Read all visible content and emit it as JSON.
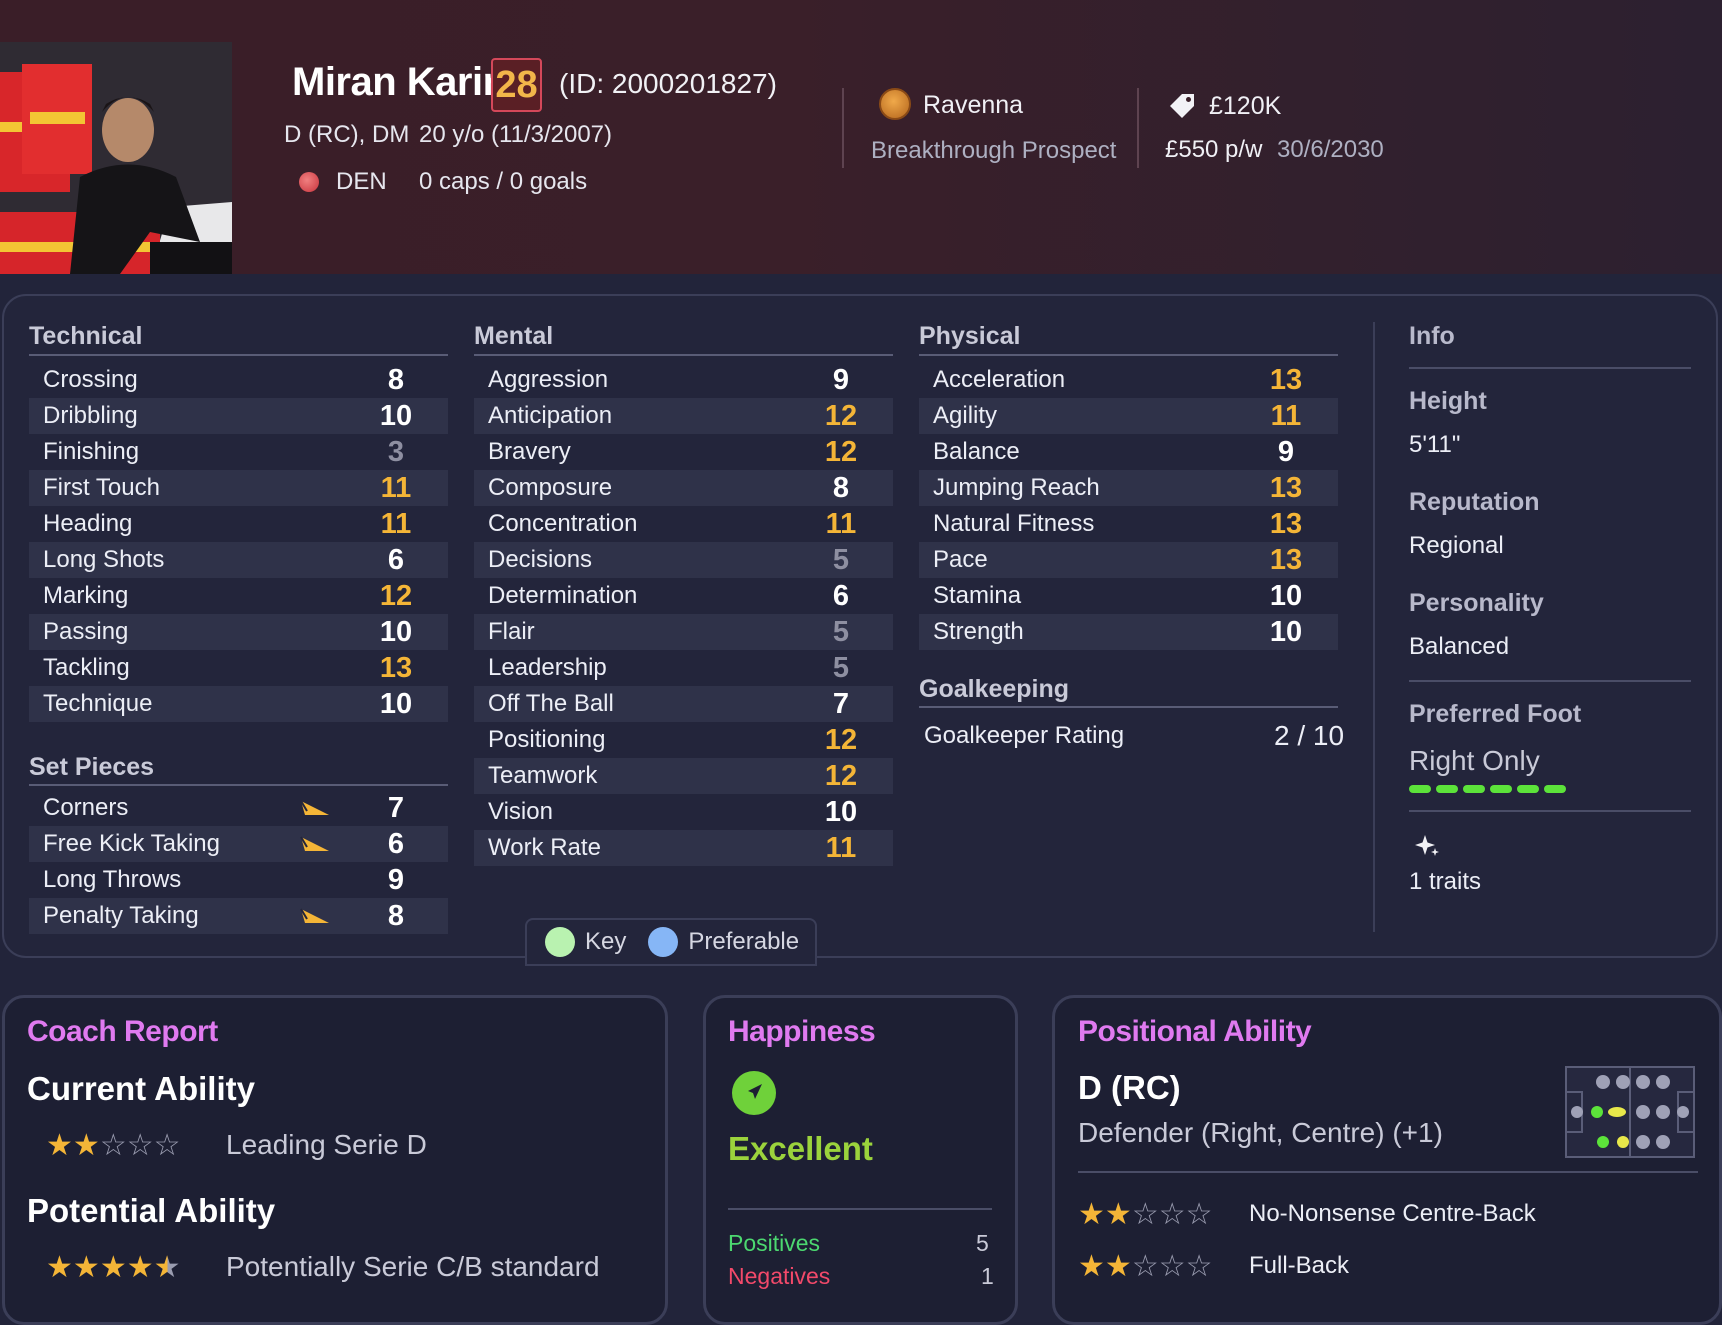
{
  "player": {
    "name": "Miran Karim",
    "ability_badge": "28",
    "id_text": "(ID: 2000201827)",
    "positions": "D (RC), DM",
    "age": "20 y/o (11/3/2007)",
    "nationality": "DEN",
    "caps": "0 caps / 0 goals",
    "club": "Ravenna",
    "status": "Breakthrough Prospect",
    "value": "£120K",
    "wage": "£550 p/w",
    "contract_expiry": "30/6/2030"
  },
  "colors": {
    "white": "#ffffff",
    "gold": "#f4b537",
    "grey": "#8e8fa1",
    "key": "#b9f2b0",
    "preferable": "#86b6f6",
    "foot_bar": "#5ce33a",
    "coach_title": "#e07af0",
    "happy_text": "#9bd33c",
    "positives": "#4cd870",
    "negatives": "#f2496a"
  },
  "technical": {
    "title": "Technical",
    "rows": [
      {
        "label": "Crossing",
        "value": "8",
        "tone": "white"
      },
      {
        "label": "Dribbling",
        "value": "10",
        "tone": "white"
      },
      {
        "label": "Finishing",
        "value": "3",
        "tone": "grey"
      },
      {
        "label": "First Touch",
        "value": "11",
        "tone": "gold"
      },
      {
        "label": "Heading",
        "value": "11",
        "tone": "gold"
      },
      {
        "label": "Long Shots",
        "value": "6",
        "tone": "white"
      },
      {
        "label": "Marking",
        "value": "12",
        "tone": "gold"
      },
      {
        "label": "Passing",
        "value": "10",
        "tone": "white"
      },
      {
        "label": "Tackling",
        "value": "13",
        "tone": "gold"
      },
      {
        "label": "Technique",
        "value": "10",
        "tone": "white"
      }
    ]
  },
  "set_pieces": {
    "title": "Set Pieces",
    "rows": [
      {
        "label": "Corners",
        "value": "7",
        "tone": "white",
        "icon": "set-piece-taker-icon"
      },
      {
        "label": "Free Kick Taking",
        "value": "6",
        "tone": "white",
        "icon": "set-piece-taker-icon"
      },
      {
        "label": "Long Throws",
        "value": "9",
        "tone": "white"
      },
      {
        "label": "Penalty Taking",
        "value": "8",
        "tone": "white",
        "icon": "set-piece-taker-icon"
      }
    ]
  },
  "mental": {
    "title": "Mental",
    "rows": [
      {
        "label": "Aggression",
        "value": "9",
        "tone": "white"
      },
      {
        "label": "Anticipation",
        "value": "12",
        "tone": "gold"
      },
      {
        "label": "Bravery",
        "value": "12",
        "tone": "gold"
      },
      {
        "label": "Composure",
        "value": "8",
        "tone": "white"
      },
      {
        "label": "Concentration",
        "value": "11",
        "tone": "gold"
      },
      {
        "label": "Decisions",
        "value": "5",
        "tone": "grey"
      },
      {
        "label": "Determination",
        "value": "6",
        "tone": "white"
      },
      {
        "label": "Flair",
        "value": "5",
        "tone": "grey"
      },
      {
        "label": "Leadership",
        "value": "5",
        "tone": "grey"
      },
      {
        "label": "Off The Ball",
        "value": "7",
        "tone": "white"
      },
      {
        "label": "Positioning",
        "value": "12",
        "tone": "gold"
      },
      {
        "label": "Teamwork",
        "value": "12",
        "tone": "gold"
      },
      {
        "label": "Vision",
        "value": "10",
        "tone": "white"
      },
      {
        "label": "Work Rate",
        "value": "11",
        "tone": "gold"
      }
    ]
  },
  "physical": {
    "title": "Physical",
    "rows": [
      {
        "label": "Acceleration",
        "value": "13",
        "tone": "gold"
      },
      {
        "label": "Agility",
        "value": "11",
        "tone": "gold"
      },
      {
        "label": "Balance",
        "value": "9",
        "tone": "white"
      },
      {
        "label": "Jumping Reach",
        "value": "13",
        "tone": "gold"
      },
      {
        "label": "Natural Fitness",
        "value": "13",
        "tone": "gold"
      },
      {
        "label": "Pace",
        "value": "13",
        "tone": "gold"
      },
      {
        "label": "Stamina",
        "value": "10",
        "tone": "white"
      },
      {
        "label": "Strength",
        "value": "10",
        "tone": "white"
      }
    ]
  },
  "goalkeeping": {
    "title": "Goalkeeping",
    "label": "Goalkeeper Rating",
    "value": "2 / 10"
  },
  "legend": {
    "key": "Key",
    "preferable": "Preferable"
  },
  "info": {
    "title": "Info",
    "height_label": "Height",
    "height_value": "5'11\"",
    "reputation_label": "Reputation",
    "reputation_value": "Regional",
    "personality_label": "Personality",
    "personality_value": "Balanced",
    "foot_label": "Preferred Foot",
    "foot_value": "Right Only",
    "foot_level": 6,
    "traits": "1 traits"
  },
  "coach_report": {
    "title": "Coach Report",
    "current_label": "Current Ability",
    "current_stars": 2,
    "current_desc": "Leading Serie D",
    "potential_label": "Potential Ability",
    "potential_stars": 4.5,
    "potential_desc": "Potentially Serie C/B standard"
  },
  "happiness": {
    "title": "Happiness",
    "level": "Excellent",
    "positives_label": "Positives",
    "positives_value": "5",
    "negatives_label": "Negatives",
    "negatives_value": "1"
  },
  "positional": {
    "title": "Positional Ability",
    "position": "D (RC)",
    "detail": "Defender (Right, Centre) (+1)",
    "roles": [
      {
        "name": "No-Nonsense Centre-Back",
        "stars": 2
      },
      {
        "name": "Full-Back",
        "stars": 2
      }
    ]
  }
}
